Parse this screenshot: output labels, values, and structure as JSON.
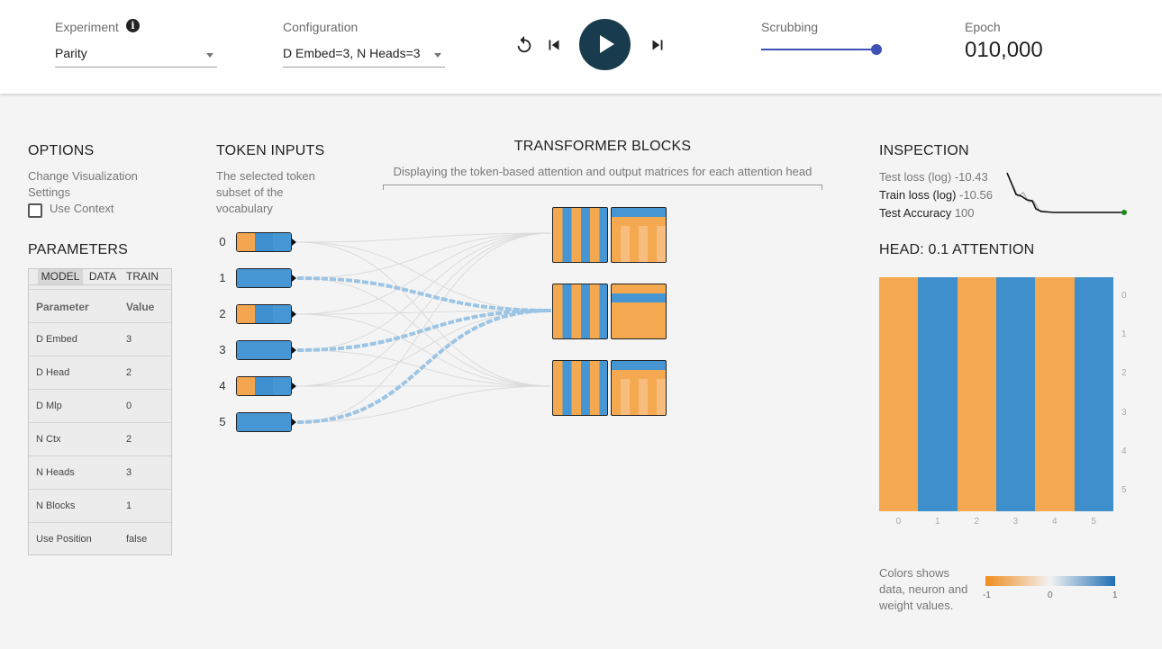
{
  "topbar": {
    "experiment_label": "Experiment",
    "experiment_value": "Parity",
    "configuration_label": "Configuration",
    "configuration_value": "D Embed=3, N Heads=3",
    "scrubbing_label": "Scrubbing",
    "scrubbing_position": 1.0,
    "epoch_label": "Epoch",
    "epoch_value": "010,000",
    "icons": [
      "info-icon",
      "reset-icon",
      "skip-previous-icon",
      "play-icon",
      "skip-next-icon"
    ]
  },
  "options": {
    "title": "OPTIONS",
    "subtitle": "Change Visualization Settings",
    "use_context_label": "Use Context",
    "use_context_checked": false
  },
  "parameters": {
    "title": "PARAMETERS",
    "tabs": [
      "MODEL",
      "DATA",
      "TRAIN"
    ],
    "active_tab": "MODEL",
    "header": [
      "Parameter",
      "Value"
    ],
    "rows": [
      [
        "D Embed",
        "3"
      ],
      [
        "D Head",
        "2"
      ],
      [
        "D Mlp",
        "0"
      ],
      [
        "N Ctx",
        "2"
      ],
      [
        "N Heads",
        "3"
      ],
      [
        "N Blocks",
        "1"
      ],
      [
        "Use Position",
        "false"
      ]
    ]
  },
  "token_inputs": {
    "title": "TOKEN INPUTS",
    "subtitle": "The selected token subset of the vocabulary",
    "tokens": [
      {
        "label": "0",
        "colors": [
          "#f3a64f",
          "#3d8fd0",
          "#4596d3"
        ]
      },
      {
        "label": "1",
        "colors": [
          "#4596d3",
          "#4596d3",
          "#4596d3"
        ]
      },
      {
        "label": "2",
        "colors": [
          "#f3a64f",
          "#3d8fd0",
          "#4596d3"
        ]
      },
      {
        "label": "3",
        "colors": [
          "#4596d3",
          "#4596d3",
          "#4596d3"
        ]
      },
      {
        "label": "4",
        "colors": [
          "#f3a64f",
          "#3d8fd0",
          "#4596d3"
        ]
      },
      {
        "label": "5",
        "colors": [
          "#4596d3",
          "#4596d3",
          "#4596d3"
        ]
      }
    ]
  },
  "transformer_blocks": {
    "title": "TRANSFORMER BLOCKS",
    "subtitle": "Displaying the token-based attention and output matrices for each attention head"
  },
  "inspection": {
    "title": "INSPECTION",
    "test_loss_label": "Test loss (log)",
    "test_loss_value": "-10.43",
    "train_loss_label": "Train loss (log)",
    "train_loss_value": "-10.56",
    "test_accuracy_label": "Test Accuracy",
    "test_accuracy_value": "100"
  },
  "head": {
    "title": "HEAD: 0.1 ATTENTION",
    "x_ticks": [
      "0",
      "1",
      "2",
      "3",
      "4",
      "5"
    ],
    "y_ticks": [
      "0",
      "1",
      "2",
      "3",
      "4",
      "5"
    ],
    "column_colors": [
      "#f4a84f",
      "#3f8fcc",
      "#f4a84f",
      "#3f8fcc",
      "#f4a84f",
      "#3f8fcc"
    ]
  },
  "legend": {
    "text": "Colors shows data, neuron and weight values.",
    "ticks": [
      "-1",
      "0",
      "1"
    ],
    "colors": {
      "negative": "#f08c1e",
      "neutral": "#f2f2f2",
      "positive": "#1f6fb4"
    }
  },
  "colors": {
    "orange": "#f4a84f",
    "blue": "#4596d3",
    "dark": "#183c4e",
    "accent": "#3f51b5"
  }
}
